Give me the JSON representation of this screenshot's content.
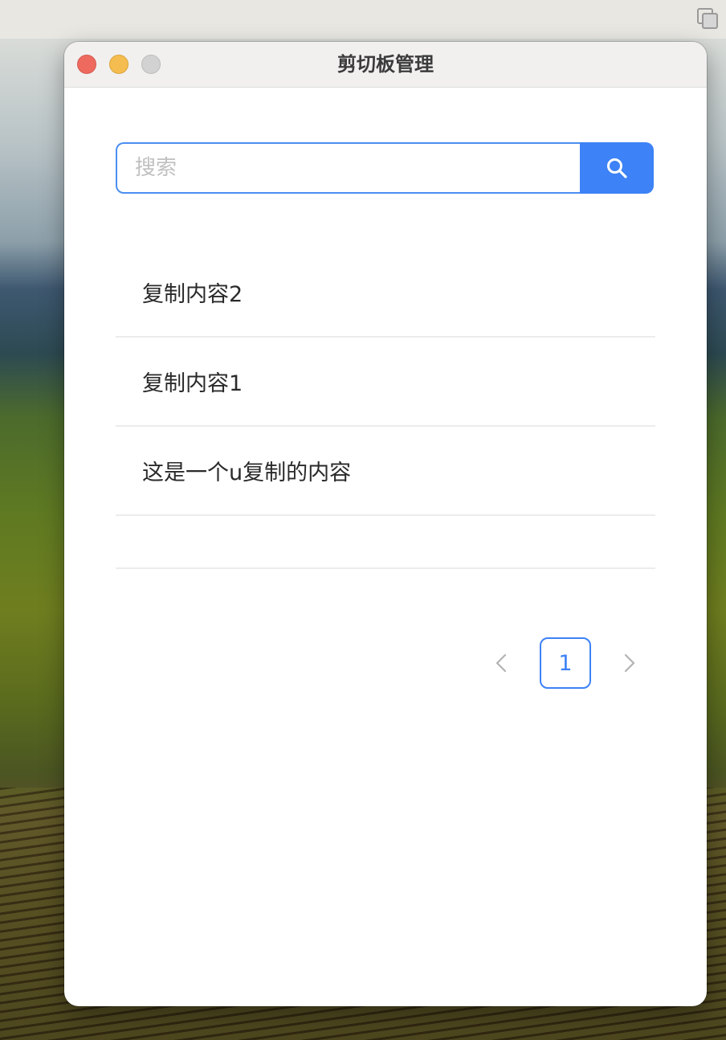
{
  "window": {
    "title": "剪切板管理"
  },
  "search": {
    "placeholder": "搜索",
    "value": "",
    "button_icon": "search-icon"
  },
  "clipboard": {
    "items": [
      {
        "text": "复制内容2"
      },
      {
        "text": "复制内容1"
      },
      {
        "text": "这是一个u复制的内容"
      }
    ]
  },
  "pagination": {
    "prev_label": "<",
    "current_page": "1",
    "next_label": ">"
  },
  "colors": {
    "accent": "#3d82f6",
    "close": "#ee6a5f",
    "minimize": "#f5bd4f",
    "maximize": "#d3d2d2"
  }
}
